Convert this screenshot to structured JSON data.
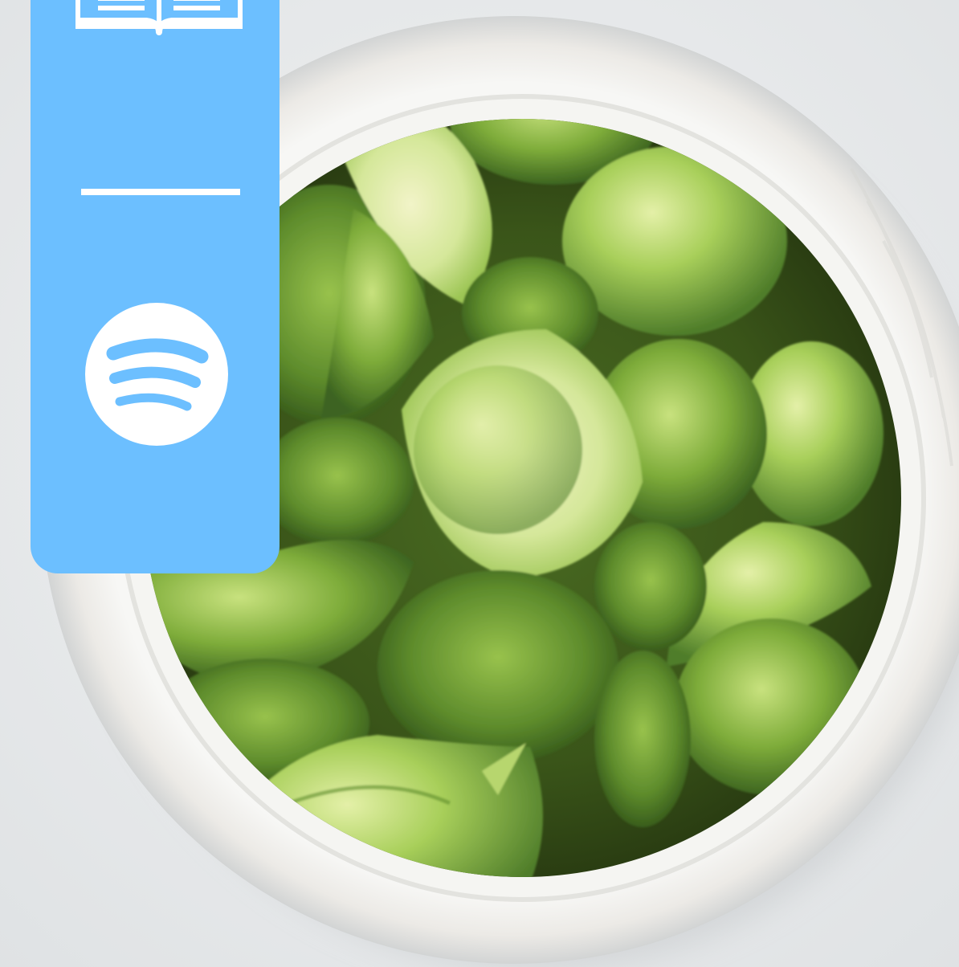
{
  "photo": {
    "subject": "bowl-of-brussels-sprouts"
  },
  "side_panel": {
    "background_color": "#6cbfff",
    "foreground_color": "#ffffff",
    "items": [
      {
        "icon": "open-book-icon"
      },
      {
        "icon": "divider"
      },
      {
        "icon": "spotify-icon"
      }
    ]
  },
  "colors": {
    "page_background": "#e9ebec",
    "bowl": "#f4f4f2",
    "sprout_light": "#b8d77a",
    "sprout_dark": "#4f7d2a"
  }
}
